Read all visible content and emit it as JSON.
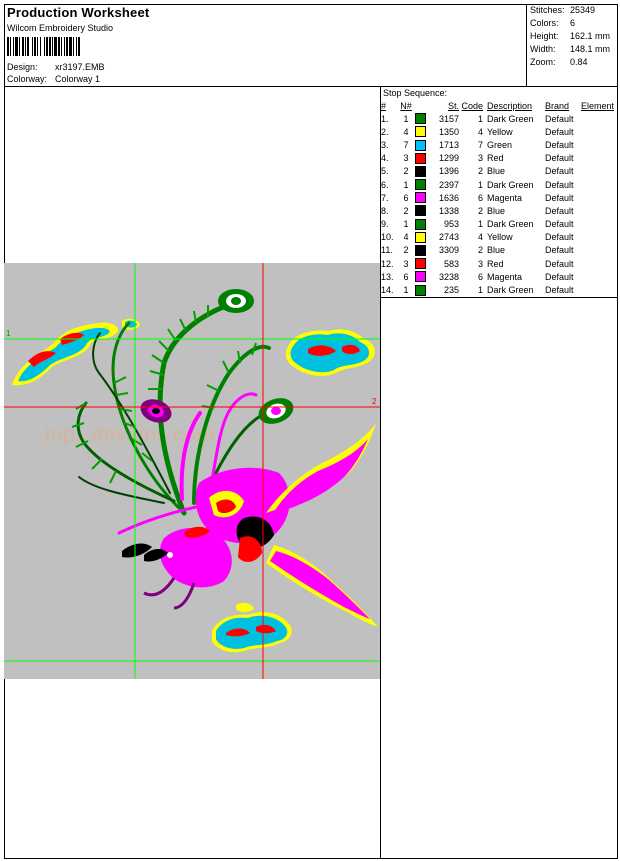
{
  "header": {
    "title": "Production Worksheet",
    "company": "Wilcom Embroidery Studio",
    "design_label": "Design:",
    "design_value": "xr3197.EMB",
    "colorway_label": "Colorway:",
    "colorway_value": "Colorway 1"
  },
  "stats": [
    {
      "label": "Stitches:",
      "value": "25349"
    },
    {
      "label": "Colors:",
      "value": "6"
    },
    {
      "label": "Height:",
      "value": "162.1 mm"
    },
    {
      "label": "Width:",
      "value": "148.1 mm"
    },
    {
      "label": "Zoom:",
      "value": "0.84"
    }
  ],
  "stop_sequence": {
    "title": "Stop Sequence:",
    "columns": [
      "#",
      "N#",
      "St.",
      "Code",
      "Description",
      "Brand",
      "Element"
    ],
    "rows": [
      {
        "num": "1.",
        "n": "1",
        "color": "#008000",
        "st": "3157",
        "code": "1",
        "desc": "Dark Green",
        "brand": "Default"
      },
      {
        "num": "2.",
        "n": "4",
        "color": "#ffff00",
        "st": "1350",
        "code": "4",
        "desc": "Yellow",
        "brand": "Default"
      },
      {
        "num": "3.",
        "n": "7",
        "color": "#00c0ff",
        "st": "1713",
        "code": "7",
        "desc": "Green",
        "brand": "Default"
      },
      {
        "num": "4.",
        "n": "3",
        "color": "#ff0000",
        "st": "1299",
        "code": "3",
        "desc": "Red",
        "brand": "Default"
      },
      {
        "num": "5.",
        "n": "2",
        "color": "#000000",
        "st": "1396",
        "code": "2",
        "desc": "Blue",
        "brand": "Default"
      },
      {
        "num": "6.",
        "n": "1",
        "color": "#008000",
        "st": "2397",
        "code": "1",
        "desc": "Dark Green",
        "brand": "Default"
      },
      {
        "num": "7.",
        "n": "6",
        "color": "#ff00ff",
        "st": "1636",
        "code": "6",
        "desc": "Magenta",
        "brand": "Default"
      },
      {
        "num": "8.",
        "n": "2",
        "color": "#000000",
        "st": "1338",
        "code": "2",
        "desc": "Blue",
        "brand": "Default"
      },
      {
        "num": "9.",
        "n": "1",
        "color": "#008000",
        "st": "953",
        "code": "1",
        "desc": "Dark Green",
        "brand": "Default"
      },
      {
        "num": "10.",
        "n": "4",
        "color": "#ffff00",
        "st": "2743",
        "code": "4",
        "desc": "Yellow",
        "brand": "Default"
      },
      {
        "num": "11.",
        "n": "2",
        "color": "#000000",
        "st": "3309",
        "code": "2",
        "desc": "Blue",
        "brand": "Default"
      },
      {
        "num": "12.",
        "n": "3",
        "color": "#ff0000",
        "st": "583",
        "code": "3",
        "desc": "Red",
        "brand": "Default"
      },
      {
        "num": "13.",
        "n": "6",
        "color": "#ff00ff",
        "st": "3238",
        "code": "6",
        "desc": "Magenta",
        "brand": "Default"
      },
      {
        "num": "14.",
        "n": "1",
        "color": "#008000",
        "st": "235",
        "code": "1",
        "desc": "Dark Green",
        "brand": "Default"
      }
    ]
  },
  "preview": {
    "guide_labels": [
      "1",
      "2"
    ],
    "watermark": "top...designs.com",
    "colors": {
      "background": "#c0c0c0",
      "guide_green": "#00ff00",
      "guide_red": "#ff0000"
    }
  }
}
